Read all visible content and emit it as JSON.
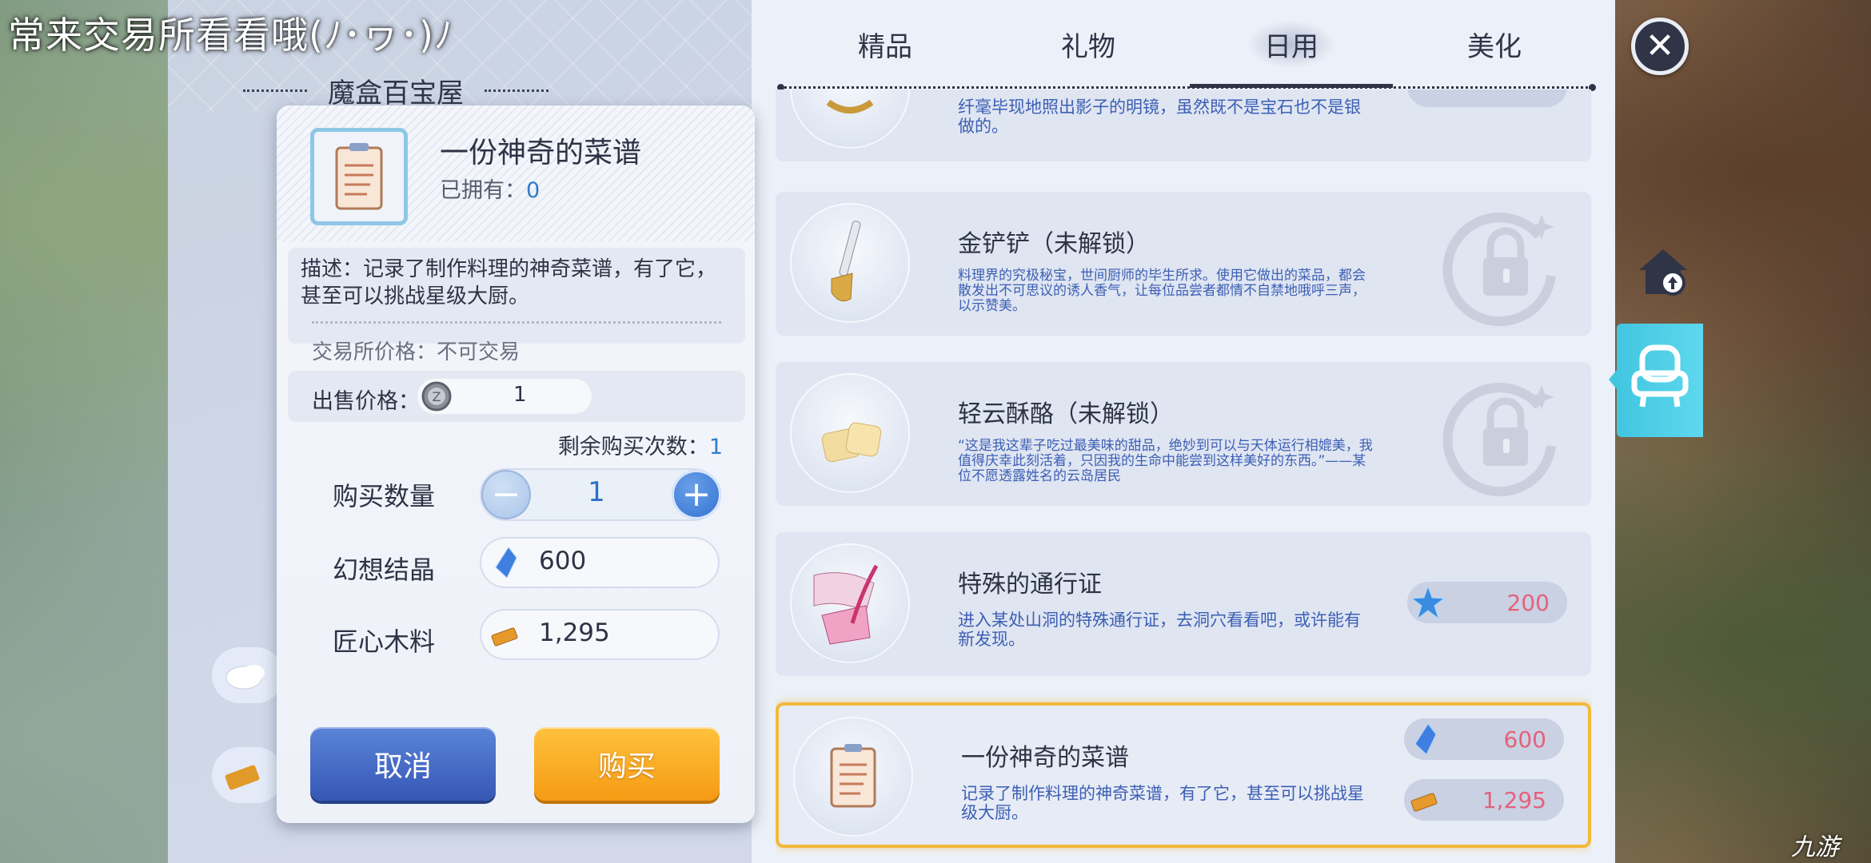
{
  "overlay_caption": "常来交易所看看哦(ﾉ･ヮ･)ﾉ",
  "shop_title": "魔盒百宝屋",
  "tabs": [
    {
      "label": "精品",
      "active": false
    },
    {
      "label": "礼物",
      "active": false
    },
    {
      "label": "日用",
      "active": true
    },
    {
      "label": "美化",
      "active": false
    }
  ],
  "items": [
    {
      "name": "",
      "desc": "纤毫毕现地照出影子的明镜，虽然既不是宝石也不是银做的。",
      "icon": "mirror-icon"
    },
    {
      "name": "金铲铲（未解锁）",
      "desc": "料理界的究极秘宝，世间厨师的毕生所求。使用它做出的菜品，都会散发出不可思议的诱人香气，让每位品尝者都情不自禁地哦呼三声，以示赞美。",
      "icon": "golden-shovel-icon",
      "locked": true
    },
    {
      "name": "轻云酥酪（未解锁）",
      "desc": "“这是我这辈子吃过最美味的甜品，绝妙到可以与天体运行相媲美，我值得庆幸此刻活着，只因我的生命中能尝到这样美好的东西。”——某位不愿透露姓名的云岛居民",
      "icon": "cloud-pastry-icon",
      "locked": true
    },
    {
      "name": "特殊的通行证",
      "desc": "进入某处山洞的特殊通行证，去洞穴看看吧，或许能有新发现。",
      "icon": "special-pass-icon",
      "prices": [
        {
          "icon": "star-crystal-icon",
          "value": "200"
        }
      ]
    },
    {
      "name": "一份神奇的菜谱",
      "desc": "记录了制作料理的神奇菜谱，有了它，甚至可以挑战星级大厨。",
      "icon": "recipe-icon",
      "selected": true,
      "prices": [
        {
          "icon": "fantasy-crystal-icon",
          "value": "600"
        },
        {
          "icon": "wood-icon",
          "value": "1,295"
        }
      ]
    }
  ],
  "dialog": {
    "item_name": "一份神奇的菜谱",
    "owned_label": "已拥有：",
    "owned_count": "0",
    "description": "描述：记录了制作料理的神奇菜谱，有了它，甚至可以挑战星级大厨。",
    "trade_price": "交易所价格：不可交易",
    "sell_label": "出售价格：",
    "sell_value": "1",
    "remain_label": "剩余购买次数：",
    "remain_count": "1",
    "qty_label": "购买数量",
    "qty_value": "1",
    "costs": [
      {
        "label": "幻想结晶",
        "value": "600",
        "icon": "fantasy-crystal-icon"
      },
      {
        "label": "匠心木料",
        "value": "1,295",
        "icon": "wood-icon"
      }
    ],
    "cancel_label": "取消",
    "buy_label": "购买"
  },
  "close_label": "✕",
  "watermark": "九游",
  "colors": {
    "accent_blue": "#3657b5",
    "accent_orange": "#f59a14",
    "price_pink": "#e4617b",
    "selected_border": "#f2b93b",
    "side_tab_cyan": "#42c6e0"
  }
}
